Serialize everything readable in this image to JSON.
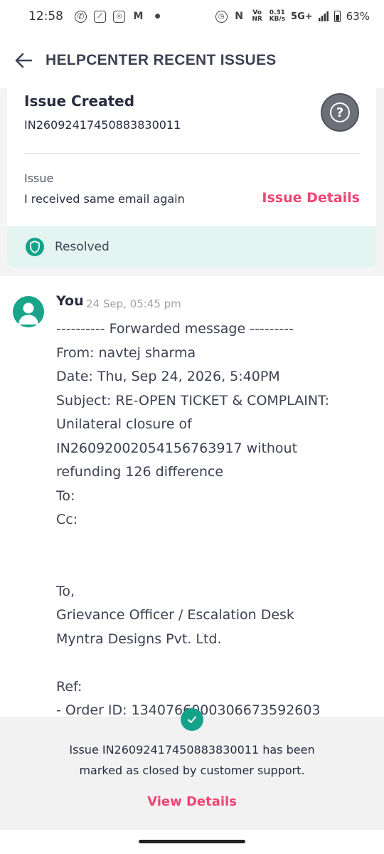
{
  "status_bar": {
    "time": "12:58",
    "speed_value": "0.31",
    "speed_unit": "KB/s",
    "volte": "Vo NR",
    "network": "5G+",
    "battery": "63%",
    "left_icons": [
      "whatsapp-icon",
      "app-icon",
      "instagram-icon",
      "myntra-icon",
      "dot-icon"
    ],
    "right_icons": [
      "alarm-icon",
      "nfc-icon",
      "signal-icon",
      "battery-icon"
    ]
  },
  "app_bar": {
    "title": "HELPCENTER RECENT ISSUES"
  },
  "issue_card": {
    "status_label": "Issue Created",
    "issue_id": "IN26092417450883830011",
    "issue_label": "Issue",
    "issue_text": "I received same email again",
    "details_link": "Issue Details",
    "resolved_label": "Resolved"
  },
  "message": {
    "sender": "You",
    "time": "24 Sep, 05:45 pm",
    "lines": [
      "---------- Forwarded message ---------",
      "From: navtej sharma",
      "Date: Thu, Sep 24, 2026, 5:40PM",
      "Subject: RE-OPEN TICKET & COMPLAINT:",
      "Unilateral closure of",
      "IN26092002054156763917 without",
      "refunding 126 difference",
      "To:",
      "Cc:",
      "",
      "",
      "To,",
      "Grievance Officer / Escalation Desk",
      "Myntra Designs Pvt. Ltd.",
      "",
      "Ref:",
      "- Order ID: 1340766000306673592603"
    ]
  },
  "toast": {
    "line1": "Issue IN26092417450883830011 has been",
    "line2": "marked as closed by customer support.",
    "link": "View Details"
  },
  "colors": {
    "accent_pink": "#ee4574",
    "success_green": "#14a38a",
    "resolved_bg": "#e4f4f1"
  }
}
